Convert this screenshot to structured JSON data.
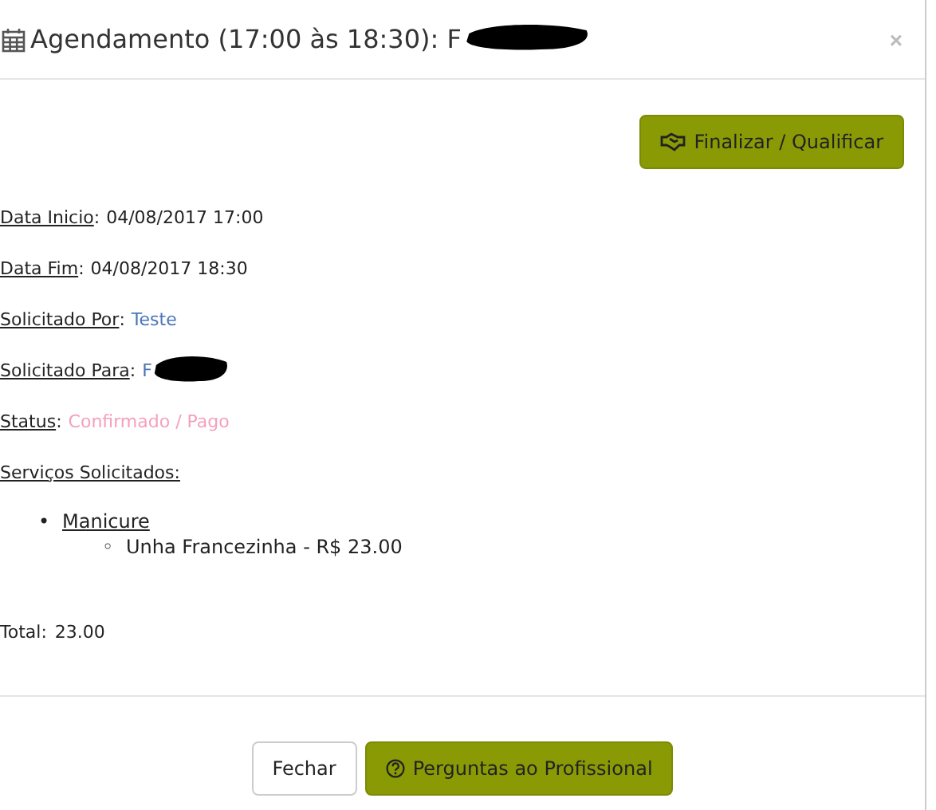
{
  "modal": {
    "title": "Agendamento (17:00 às 18:30): F",
    "title_redacted": true,
    "close": "×"
  },
  "primary_action": "Finalizar / Qualificar",
  "fields": [
    {
      "label": "Data Inicio",
      "separator": ":",
      "value": "04/08/2017 17:00",
      "kind": "plain",
      "redacted": false
    },
    {
      "label": "Data Fim",
      "separator": ":",
      "value": "04/08/2017 18:30",
      "kind": "plain",
      "redacted": false
    },
    {
      "label": "Solicitado Por",
      "separator": ":",
      "value": "Teste",
      "kind": "link",
      "redacted": false
    },
    {
      "label": "Solicitado Para",
      "separator": ":",
      "value": "F",
      "kind": "link",
      "redacted": true
    },
    {
      "label": "Status",
      "separator": ":",
      "value": "Confirmado / Pago",
      "kind": "status",
      "redacted": false
    }
  ],
  "services": {
    "heading": "Serviços Solicitados:",
    "items": [
      {
        "marker": "•",
        "name": "Manicure",
        "children": [
          {
            "marker": "◦",
            "name": "Unha Francezinha - R$ 23.00"
          }
        ]
      }
    ]
  },
  "total": {
    "label": "Total:",
    "value": "23.00"
  },
  "footer_buttons": [
    {
      "label": "Fechar",
      "kind": "default"
    },
    {
      "label": "Perguntas ao Profissional",
      "kind": "primary"
    }
  ]
}
